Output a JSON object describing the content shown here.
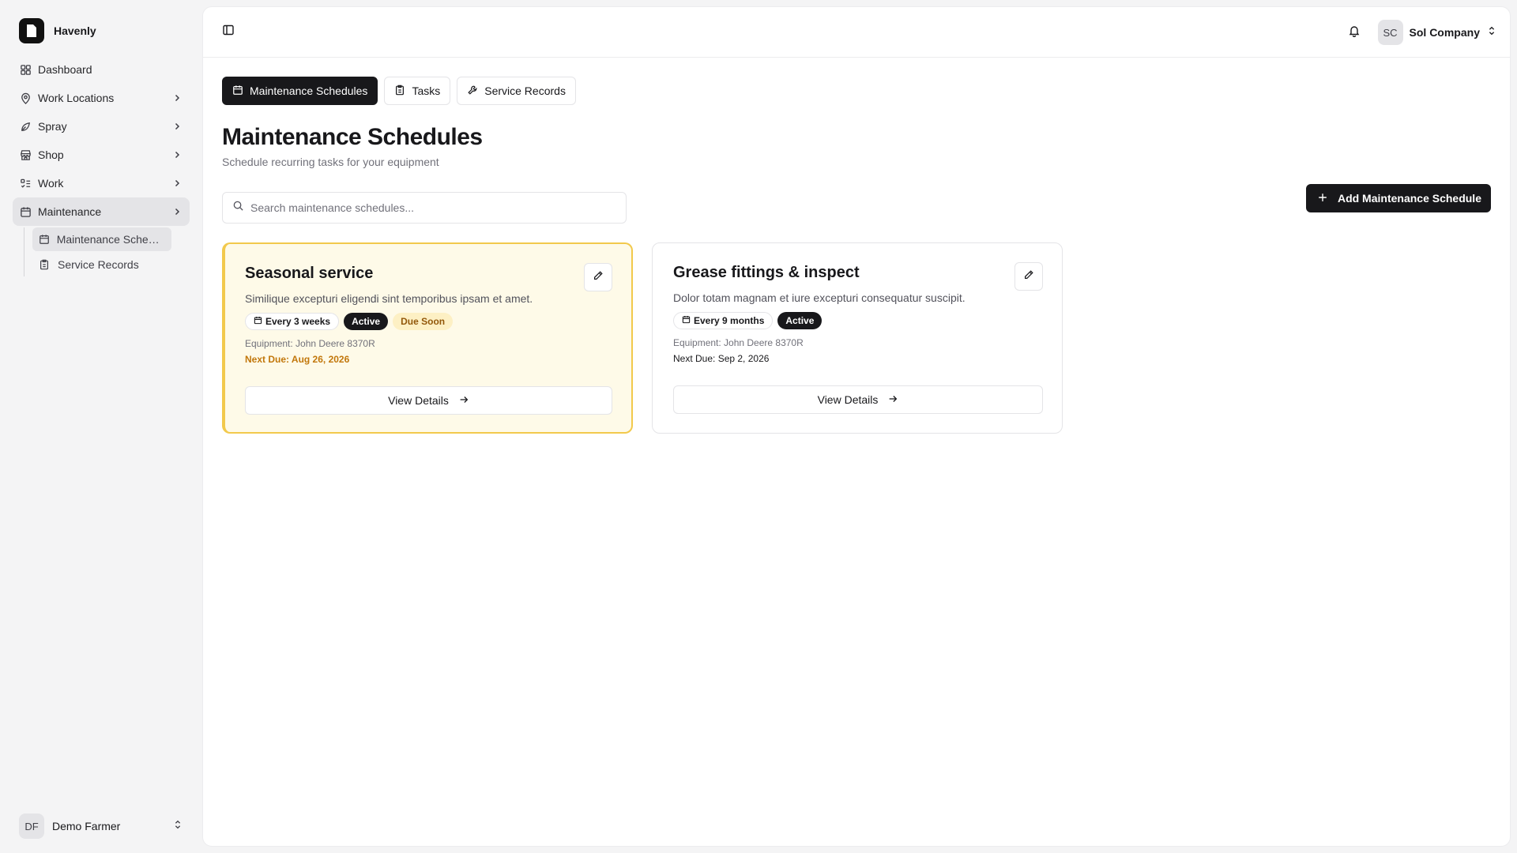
{
  "app": {
    "name": "Havenly"
  },
  "sidebar": {
    "items": [
      {
        "label": "Dashboard",
        "icon": "grid-icon"
      },
      {
        "label": "Work Locations",
        "icon": "map-pin-icon"
      },
      {
        "label": "Spray",
        "icon": "spray-icon"
      },
      {
        "label": "Shop",
        "icon": "store-icon"
      },
      {
        "label": "Work",
        "icon": "list-check-icon"
      },
      {
        "label": "Maintenance",
        "icon": "calendar-icon"
      }
    ],
    "subitems": [
      {
        "label": "Maintenance Schedules",
        "icon": "calendar-icon"
      },
      {
        "label": "Service Records",
        "icon": "clipboard-icon"
      }
    ],
    "user": {
      "initials": "DF",
      "name": "Demo Farmer"
    }
  },
  "topbar": {
    "company_initials": "SC",
    "company_name": "Sol Company"
  },
  "tabs": [
    {
      "label": "Maintenance Schedules",
      "icon": "calendar-icon"
    },
    {
      "label": "Tasks",
      "icon": "clipboard-icon"
    },
    {
      "label": "Service Records",
      "icon": "wrench-icon"
    }
  ],
  "page": {
    "title": "Maintenance Schedules",
    "subtitle": "Schedule recurring tasks for your equipment",
    "add_button": "Add Maintenance Schedule",
    "search_placeholder": "Search maintenance schedules..."
  },
  "cards": [
    {
      "title": "Seasonal service",
      "description": "Similique excepturi eligendi sint temporibus ipsam et amet.",
      "frequency": "Every 3 weeks",
      "status": "Active",
      "alert": "Due Soon",
      "equipment": "Equipment: John Deere 8370R",
      "next_due": "Next Due: Aug 26, 2026",
      "view_label": "View Details"
    },
    {
      "title": "Grease fittings & inspect",
      "description": "Dolor totam magnam et iure excepturi consequatur suscipit.",
      "frequency": "Every 9 months",
      "status": "Active",
      "equipment": "Equipment: John Deere 8370R",
      "next_due": "Next Due: Sep 2, 2026",
      "view_label": "View Details"
    }
  ],
  "colors": {
    "accent": "#18181b",
    "warning_border": "#f2c94c",
    "warning_bg": "#fefae8",
    "warning_text": "#c2770b"
  }
}
